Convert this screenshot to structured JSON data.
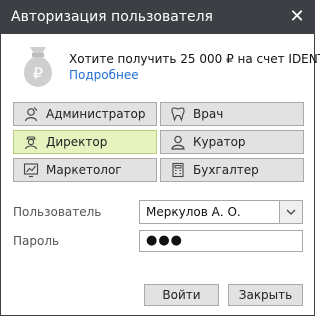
{
  "window": {
    "title": "Авторизация пользователя"
  },
  "promo": {
    "text": "Хотите получить 25 000 ₽ на счет IDENT?",
    "link": "Подробнее",
    "icon": "money-bag-ruble-icon"
  },
  "roles": [
    {
      "label": "Администратор",
      "icon": "admin-icon",
      "selected": false
    },
    {
      "label": "Врач",
      "icon": "tooth-icon",
      "selected": false
    },
    {
      "label": "Директор",
      "icon": "director-icon",
      "selected": true
    },
    {
      "label": "Куратор",
      "icon": "user-outline-icon",
      "selected": false
    },
    {
      "label": "Маркетолог",
      "icon": "chart-icon",
      "selected": false
    },
    {
      "label": "Бухгалтер",
      "icon": "calculator-icon",
      "selected": false
    }
  ],
  "form": {
    "user_label": "Пользователь",
    "user_value": "Меркулов А. О.",
    "password_label": "Пароль",
    "password_value": "●●●"
  },
  "buttons": {
    "login": "Войти",
    "close": "Закрыть"
  },
  "colors": {
    "titlebar": "#3c3f44",
    "selected_role": "#e6f3bf",
    "link": "#1e6fd6"
  }
}
